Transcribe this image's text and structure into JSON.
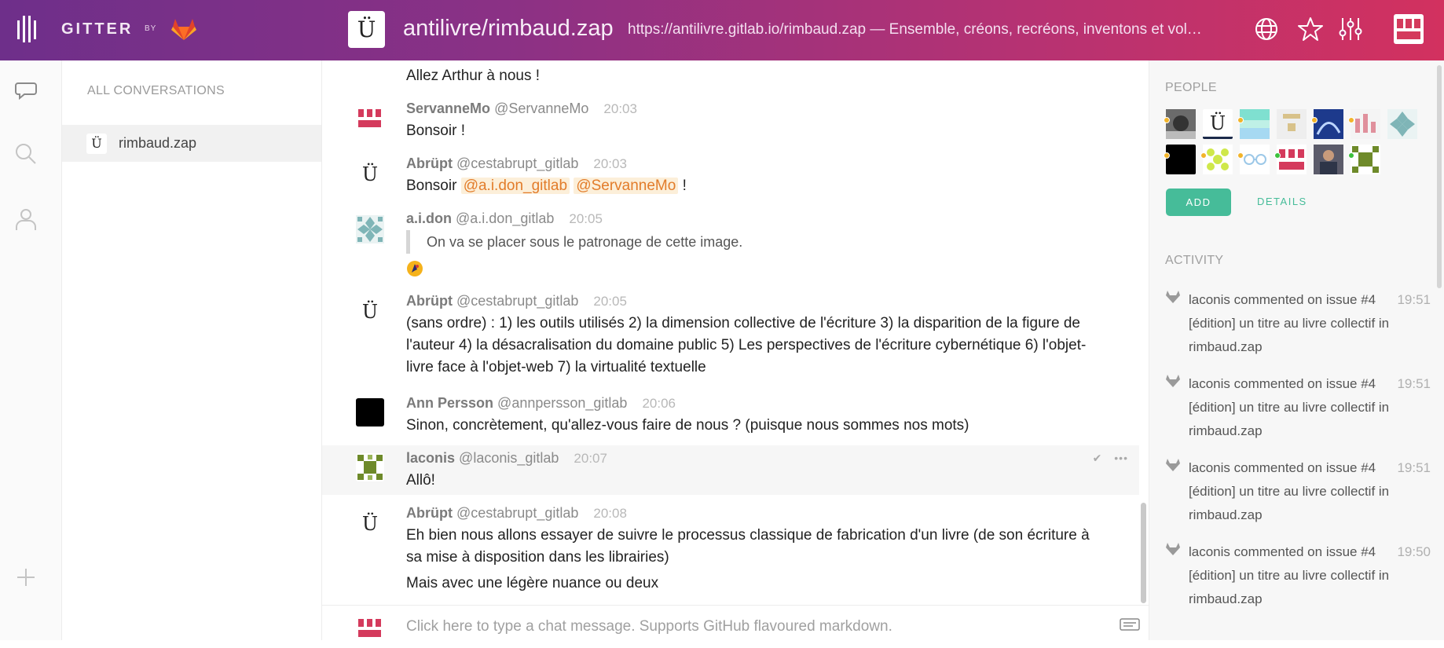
{
  "header": {
    "brand": "GITTER",
    "by": "BY",
    "room_avatar_glyph": "Ü",
    "room_name": "antilivre/rimbaud.zap",
    "room_topic": "https://antilivre.gitlab.io/rimbaud.zap — Ensemble, créons, recréons, inventons et vol…",
    "icons": [
      "globe-icon",
      "star-icon",
      "settings-sliders-icon",
      "user-avatar"
    ]
  },
  "rail": {
    "icons": [
      "chat-bubble-icon",
      "search-icon",
      "person-icon",
      "plus-icon"
    ]
  },
  "conversations": {
    "title": "ALL CONVERSATIONS",
    "items": [
      {
        "glyph": "Ü",
        "label": "rimbaud.zap"
      }
    ]
  },
  "messages": [
    {
      "body": "Allez Arthur à nous !"
    },
    {
      "name": "ServanneMo",
      "handle": "@ServanneMo",
      "time": "20:03",
      "body": "Bonsoir !"
    },
    {
      "name": "Abrüpt",
      "handle": "@cestabrupt_gitlab",
      "time": "20:03",
      "body_prefix": "Bonsoir",
      "mention1": "@a.i.don_gitlab",
      "mention2": "@ServanneMo",
      "body_suffix": "!"
    },
    {
      "name": "a.i.don",
      "handle": "@a.i.don_gitlab",
      "time": "20:05",
      "quote": "On va se placer sous le patronage de cette image."
    },
    {
      "name": "Abrüpt",
      "handle": "@cestabrupt_gitlab",
      "time": "20:05",
      "body": "(sans ordre) : 1) les outils utilisés 2) la dimension collective de l'écriture 3) la disparition de la figure de l'auteur 4) la désacralisation du domaine public 5) Les perspectives de l'écriture cybernétique 6) l'objet-livre face à l'objet-web 7) la virtualité textuelle"
    },
    {
      "name": "Ann Persson",
      "handle": "@annpersson_gitlab",
      "time": "20:06",
      "body": "Sinon, concrètement, qu'allez-vous faire de nous ? (puisque nous sommes nos mots)"
    },
    {
      "name": "laconis",
      "handle": "@laconis_gitlab",
      "time": "20:07",
      "body": "Allô!"
    },
    {
      "name": "Abrüpt",
      "handle": "@cestabrupt_gitlab",
      "time": "20:08",
      "body": "Eh bien nous allons essayer de suivre le processus classique de fabrication d'un livre (de son écriture à sa mise à disposition dans les librairies)",
      "body2": "Mais avec une légère nuance ou deux"
    }
  ],
  "avatar_glyph": "Ü",
  "chat_input": {
    "placeholder": "Click here to type a chat message. Supports GitHub flavoured markdown."
  },
  "people": {
    "title": "PEOPLE",
    "add_label": "ADD",
    "details_label": "DETAILS"
  },
  "activity": {
    "title": "ACTIVITY",
    "items": [
      {
        "text": "laconis commented on issue #4 [édition] un titre au livre collectif in rimbaud.zap",
        "time": "19:51"
      },
      {
        "text": "laconis commented on issue #4 [édition] un titre au livre collectif in rimbaud.zap",
        "time": "19:51"
      },
      {
        "text": "laconis commented on issue #4 [édition] un titre au livre collectif in rimbaud.zap",
        "time": "19:51"
      },
      {
        "text": "laconis commented on issue #4 [édition] un titre au livre collectif in rimbaud.zap",
        "time": "19:50"
      }
    ]
  },
  "colors": {
    "accent": "#46bc99",
    "mention": "#e27c2a",
    "header_start": "#6e2f8a",
    "header_end": "#d2315f"
  }
}
